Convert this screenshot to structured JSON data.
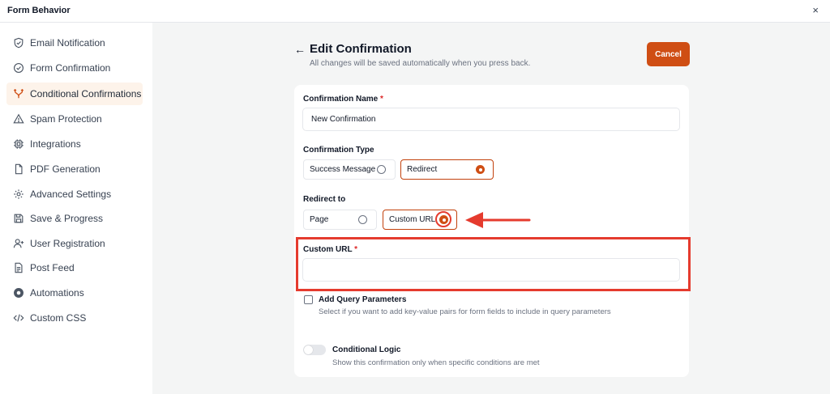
{
  "window": {
    "title": "Form Behavior",
    "close_glyph": "×"
  },
  "sidebar": {
    "active_index": 2,
    "items": [
      {
        "label": "Email Notification",
        "icon": "shield-check-icon"
      },
      {
        "label": "Form Confirmation",
        "icon": "check-circle-icon"
      },
      {
        "label": "Conditional Confirmations",
        "icon": "branch-icon"
      },
      {
        "label": "Spam Protection",
        "icon": "warning-triangle-icon"
      },
      {
        "label": "Integrations",
        "icon": "chip-icon"
      },
      {
        "label": "PDF Generation",
        "icon": "file-icon"
      },
      {
        "label": "Advanced Settings",
        "icon": "gear-icon"
      },
      {
        "label": "Save & Progress",
        "icon": "save-icon"
      },
      {
        "label": "User Registration",
        "icon": "user-plus-icon"
      },
      {
        "label": "Post Feed",
        "icon": "document-icon"
      },
      {
        "label": "Automations",
        "icon": "automation-icon"
      },
      {
        "label": "Custom CSS",
        "icon": "code-icon"
      }
    ]
  },
  "header": {
    "back_glyph": "←",
    "title": "Edit Confirmation",
    "subtitle": "All changes will be saved automatically when you press back.",
    "cancel_label": "Cancel"
  },
  "form": {
    "confirmation_name": {
      "label": "Confirmation Name",
      "required_mark": "*",
      "value": "New Confirmation"
    },
    "confirmation_type": {
      "label": "Confirmation Type",
      "options": [
        "Success Message",
        "Redirect"
      ],
      "selected": "Redirect"
    },
    "redirect_to": {
      "label": "Redirect to",
      "options": [
        "Page",
        "Custom URL"
      ],
      "selected": "Custom URL"
    },
    "custom_url": {
      "label": "Custom URL",
      "required_mark": "*",
      "value": ""
    },
    "query_params": {
      "label": "Add Query Parameters",
      "help": "Select if you want to add key-value pairs for form fields to include in query parameters",
      "checked": false
    },
    "conditional_logic": {
      "label": "Conditional Logic",
      "help": "Show this confirmation only when specific conditions are met",
      "enabled": false
    }
  },
  "colors": {
    "accent": "#cf4e14",
    "annotation": "#e53b2e",
    "active_bg": "#fdf3ea"
  }
}
